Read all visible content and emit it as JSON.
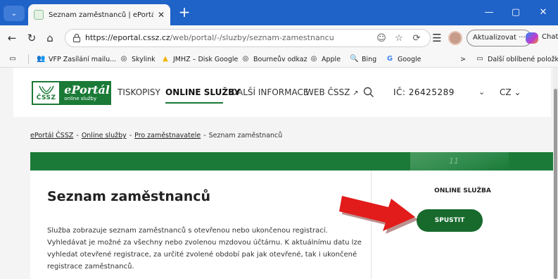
{
  "browser": {
    "tab_title": "Seznam zaměstnanců | ePortál ČSSZ",
    "tab_close": "✕",
    "new_tab": "+",
    "window_controls": {
      "minimize": "—",
      "maximize": "▢",
      "close": "✕"
    },
    "url_host": "https://eportal.cssz.cz",
    "url_path": "/web/portal/-/sluzby/seznam-zamestnancu",
    "update_label": "Aktualizovat ···",
    "chat_label": "Chat",
    "bookmarks": [
      {
        "label": "VFP Zasílání mailu...",
        "icon": "users-icon"
      },
      {
        "label": "Skylink",
        "icon": "globe-icon"
      },
      {
        "label": "JMHZ – Disk Google",
        "icon": "drive-icon"
      },
      {
        "label": "Bourneův odkaz",
        "icon": "globe-icon"
      },
      {
        "label": "Apple",
        "icon": "globe-icon"
      },
      {
        "label": "Bing",
        "icon": "search-icon"
      },
      {
        "label": "Google",
        "icon": "google-icon"
      }
    ],
    "bookmarks_overflow": ">",
    "other_favorites": "Další oblíbené položky"
  },
  "site": {
    "logo_cssz": "ČSSZ",
    "logo_title": "ePortál",
    "logo_sub": "online služby",
    "nav": {
      "forms": "TISKOPISY",
      "online": "ONLINE SLUŽBY",
      "info": "DALŠÍ INFORMACE",
      "web": "WEB ČSSZ"
    },
    "ico_label": "IČ: 26425289",
    "chevron": "⌄",
    "lang": "CZ"
  },
  "breadcrumb": {
    "home": "ePortál ČSSZ",
    "online": "Online služby",
    "employers": "Pro zaměstnavatele",
    "current": "Seznam zaměstnanců",
    "sep": "-"
  },
  "banner_number": "11",
  "page": {
    "title": "Seznam zaměstnanců",
    "description": "Služba zobrazuje seznam zaměstnanců s otevřenou nebo ukončenou registrací. Vyhledávat je možné za všechny nebo zvolenou mzdovou účtárnu. K aktuálnímu datu lze vyhledat otevřené registrace, za určité zvolené období pak jak otevřené, tak i ukončené registrace zaměstnanců."
  },
  "service": {
    "title": "ONLINE SLUŽBA",
    "run_label": "SPUSTIT"
  },
  "colors": {
    "brand_green": "#1a7a36",
    "button_green": "#176a2c",
    "titlebar_blue": "#1f62c8",
    "arrow_red": "#e21b1b"
  }
}
